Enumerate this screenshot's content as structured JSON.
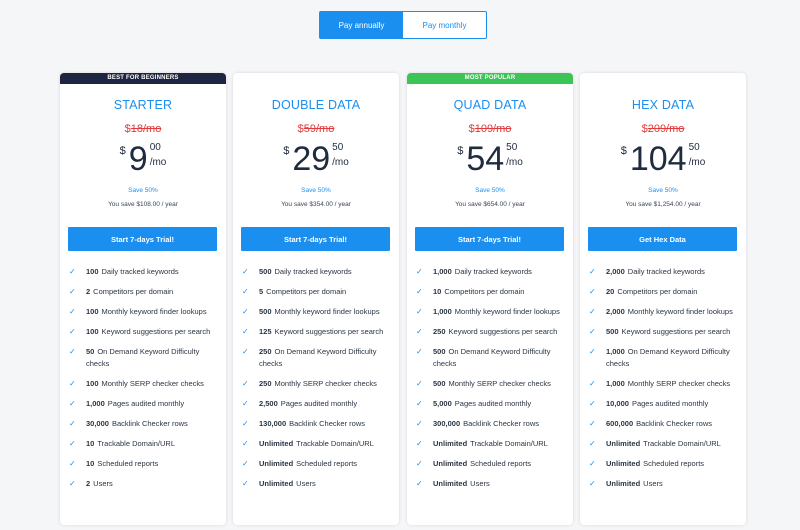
{
  "billing_toggle": {
    "annual": "Pay annually",
    "monthly": "Pay monthly"
  },
  "plans": [
    {
      "banner": "BEST FOR BEGINNERS",
      "name": "STARTER",
      "old_currency": "$",
      "old_price": "18/mo",
      "currency": "$",
      "price_whole": "9",
      "price_cents": "00",
      "per": "/mo",
      "save": "Save 50%",
      "you_save": "You save $108.00 / year",
      "cta": "Start 7-days Trial!",
      "features": [
        {
          "num": "100",
          "text": "Daily tracked keywords"
        },
        {
          "num": "2",
          "text": "Competitors per domain"
        },
        {
          "num": "100",
          "text": "Monthly keyword finder lookups"
        },
        {
          "num": "100",
          "text": "Keyword suggestions per search"
        },
        {
          "num": "50",
          "text": "On Demand Keyword Difficulty checks"
        },
        {
          "num": "100",
          "text": "Monthly SERP checker checks"
        },
        {
          "num": "1,000",
          "text": "Pages audited monthly"
        },
        {
          "num": "30,000",
          "text": "Backlink Checker rows"
        },
        {
          "num": "10",
          "text": "Trackable Domain/URL"
        },
        {
          "num": "10",
          "text": "Scheduled reports"
        },
        {
          "num": "2",
          "text": "Users"
        }
      ]
    },
    {
      "banner": "",
      "name": "DOUBLE DATA",
      "old_currency": "$",
      "old_price": "59/mo",
      "currency": "$",
      "price_whole": "29",
      "price_cents": "50",
      "per": "/mo",
      "save": "Save 50%",
      "you_save": "You save $354.00 / year",
      "cta": "Start 7-days Trial!",
      "features": [
        {
          "num": "500",
          "text": "Daily tracked keywords"
        },
        {
          "num": "5",
          "text": "Competitors per domain"
        },
        {
          "num": "500",
          "text": "Monthly keyword finder lookups"
        },
        {
          "num": "125",
          "text": "Keyword suggestions per search"
        },
        {
          "num": "250",
          "text": "On Demand Keyword Difficulty checks"
        },
        {
          "num": "250",
          "text": "Monthly SERP checker checks"
        },
        {
          "num": "2,500",
          "text": "Pages audited monthly"
        },
        {
          "num": "130,000",
          "text": "Backlink Checker rows"
        },
        {
          "num": "Unlimited",
          "text": "Trackable Domain/URL"
        },
        {
          "num": "Unlimited",
          "text": "Scheduled reports"
        },
        {
          "num": "Unlimited",
          "text": "Users"
        }
      ]
    },
    {
      "banner": "MOST POPULAR",
      "name": "QUAD DATA",
      "old_currency": "$",
      "old_price": "109/mo",
      "currency": "$",
      "price_whole": "54",
      "price_cents": "50",
      "per": "/mo",
      "save": "Save 50%",
      "you_save": "You save $654.00 / year",
      "cta": "Start 7-days Trial!",
      "features": [
        {
          "num": "1,000",
          "text": "Daily tracked keywords"
        },
        {
          "num": "10",
          "text": "Competitors per domain"
        },
        {
          "num": "1,000",
          "text": "Monthly keyword finder lookups"
        },
        {
          "num": "250",
          "text": "Keyword suggestions per search"
        },
        {
          "num": "500",
          "text": "On Demand Keyword Difficulty checks"
        },
        {
          "num": "500",
          "text": "Monthly SERP checker checks"
        },
        {
          "num": "5,000",
          "text": "Pages audited monthly"
        },
        {
          "num": "300,000",
          "text": "Backlink Checker rows"
        },
        {
          "num": "Unlimited",
          "text": "Trackable Domain/URL"
        },
        {
          "num": "Unlimited",
          "text": "Scheduled reports"
        },
        {
          "num": "Unlimited",
          "text": "Users"
        }
      ]
    },
    {
      "banner": "",
      "name": "HEX DATA",
      "old_currency": "$",
      "old_price": "209/mo",
      "currency": "$",
      "price_whole": "104",
      "price_cents": "50",
      "per": "/mo",
      "save": "Save 50%",
      "you_save": "You save $1,254.00 / year",
      "cta": "Get Hex Data",
      "features": [
        {
          "num": "2,000",
          "text": "Daily tracked keywords"
        },
        {
          "num": "20",
          "text": "Competitors per domain"
        },
        {
          "num": "2,000",
          "text": "Monthly keyword finder lookups"
        },
        {
          "num": "500",
          "text": "Keyword suggestions per search"
        },
        {
          "num": "1,000",
          "text": "On Demand Keyword Difficulty checks"
        },
        {
          "num": "1,000",
          "text": "Monthly SERP checker checks"
        },
        {
          "num": "10,000",
          "text": "Pages audited monthly"
        },
        {
          "num": "600,000",
          "text": "Backlink Checker rows"
        },
        {
          "num": "Unlimited",
          "text": "Trackable Domain/URL"
        },
        {
          "num": "Unlimited",
          "text": "Scheduled reports"
        },
        {
          "num": "Unlimited",
          "text": "Users"
        }
      ]
    }
  ],
  "icons": {
    "feature_check": "check-icon"
  },
  "colors": {
    "accent": "#1a8ff0",
    "banner_dark": "#1d2540",
    "banner_green": "#3dc457",
    "old_price": "#e03a3a"
  }
}
